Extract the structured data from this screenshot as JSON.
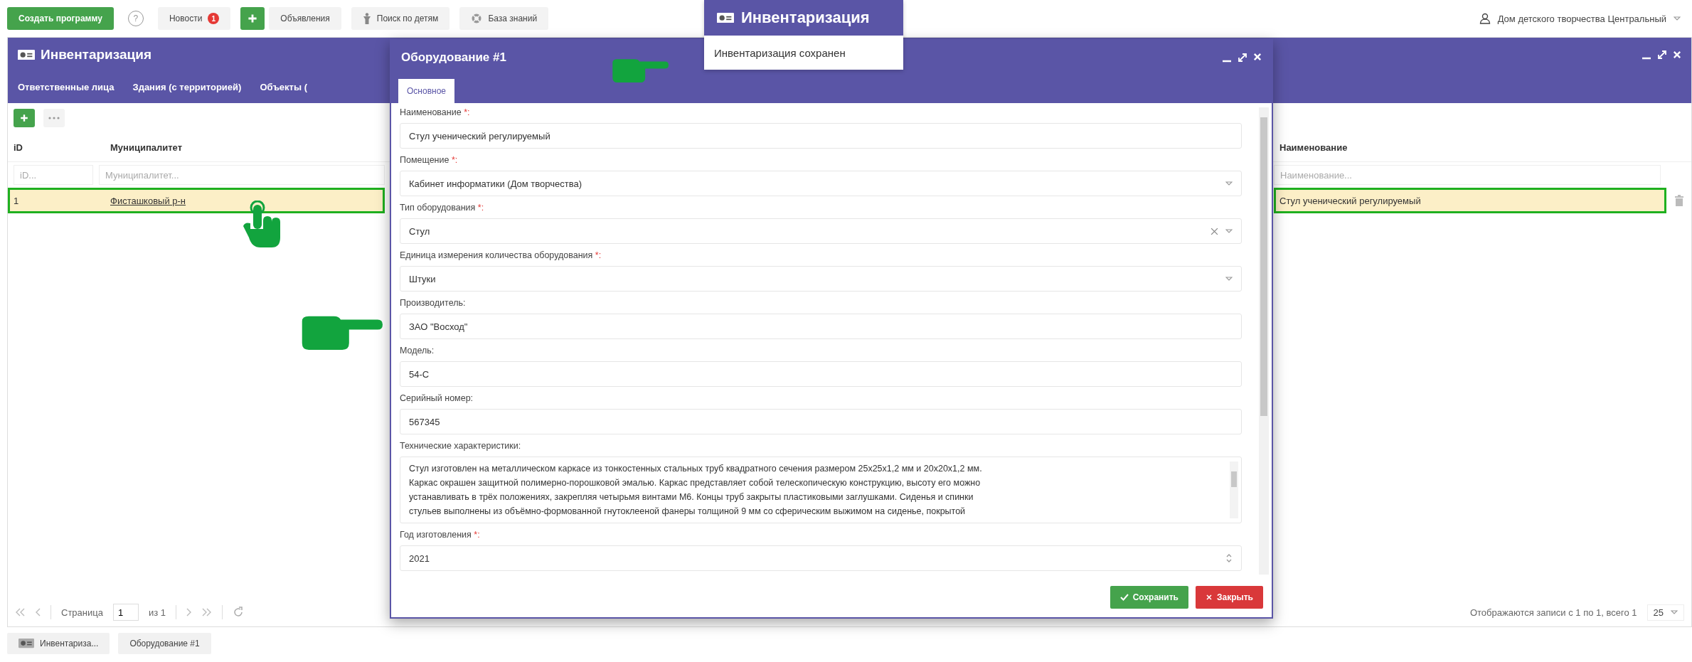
{
  "top_bar": {
    "buttons": [
      {
        "kind": "primary",
        "label": "Создать программу"
      },
      {
        "kind": "help",
        "label": "?"
      },
      {
        "kind": "news",
        "label": "Новости",
        "badge": "1"
      },
      {
        "kind": "add"
      },
      {
        "kind": "plain",
        "label": "Объявления"
      },
      {
        "kind": "search_children",
        "label": "Поиск по детям"
      },
      {
        "kind": "knowledge",
        "label": "База знаний"
      }
    ],
    "user": {
      "name": "Дом детского творчества Центральный"
    }
  },
  "toast": {
    "title": "Инвентаризация",
    "message": "Инвентаризация сохранен"
  },
  "window": {
    "title": "Инвентаризация",
    "tabs": [
      {
        "label": "Ответственные лица",
        "selected": false
      },
      {
        "label": "Здания (с территорией)",
        "selected": false
      },
      {
        "label": "Объекты (",
        "selected": false
      }
    ],
    "grid": {
      "columns": [
        {
          "title": "iD",
          "filter_placeholder": "iD..."
        },
        {
          "title": "Муниципалитет",
          "filter_placeholder": "Муниципалитет..."
        },
        {
          "title": "Наименование",
          "filter_placeholder": "Наименование..."
        }
      ],
      "rows": [
        {
          "cells": [
            "1",
            "Фисташковый р-н",
            "Стул ученический регулируемый"
          ],
          "selected": true
        }
      ]
    },
    "pager": {
      "page_label": "Страница",
      "page": "1",
      "of": "из 1",
      "summary": "Отображаются записи с 1 по 1, всего 1",
      "page_size": "25"
    }
  },
  "modal": {
    "title": "Оборудование #1",
    "tabs": [
      {
        "label": "Основное",
        "selected": true
      }
    ],
    "fields": [
      {
        "kind": "text",
        "label": "Наименование",
        "required_mark": "*:",
        "value": "Стул ученический регулируемый"
      },
      {
        "kind": "select",
        "label": "Помещение",
        "required_mark": "*:",
        "value": "Кабинет информатики (Дом творчества)"
      },
      {
        "kind": "select_clearable",
        "label": "Тип оборудования",
        "required_mark": "*:",
        "value": "Стул"
      },
      {
        "kind": "select",
        "label": "Единица измерения количества оборудования",
        "required_mark": "*:",
        "value": "Штуки"
      },
      {
        "kind": "text",
        "label": "Производитель:",
        "value": "ЗАО \"Восход\""
      },
      {
        "kind": "text",
        "label": "Модель:",
        "value": "54-С"
      },
      {
        "kind": "text",
        "label": "Серийный номер:",
        "value": "567345"
      },
      {
        "kind": "textarea",
        "label": "Технические характеристики:",
        "value": "Стул изготовлен на металлическом каркасе из тонкостенных стальных труб квадратного сечения размером 25x25x1,2 мм и 20x20x1,2 мм.\nКаркас окрашен защитной полимерно-порошковой эмалью. Каркас представляет собой телескопическую конструкцию, высоту его можно\nустанавливать в трёх положениях, закрепляя четырьмя винтами М6. Концы труб закрыты пластиковыми заглушками. Сиденья и спинки\nстульев выполнены из объёмно-формованной гнутоклееной фанеры толщиной 9 мм со сферическим выжимом на сиденье, покрытой"
      },
      {
        "kind": "number",
        "label": "Год изготовления",
        "required_mark": "*:",
        "value": "2021"
      }
    ],
    "buttons": [
      {
        "kind": "save",
        "label": "Сохранить"
      },
      {
        "kind": "close",
        "label": "Закрыть"
      }
    ]
  },
  "taskbar": [
    {
      "kind": "list",
      "label": "Инвентариза..."
    },
    {
      "kind": "form",
      "label": "Оборудование #1"
    }
  ]
}
